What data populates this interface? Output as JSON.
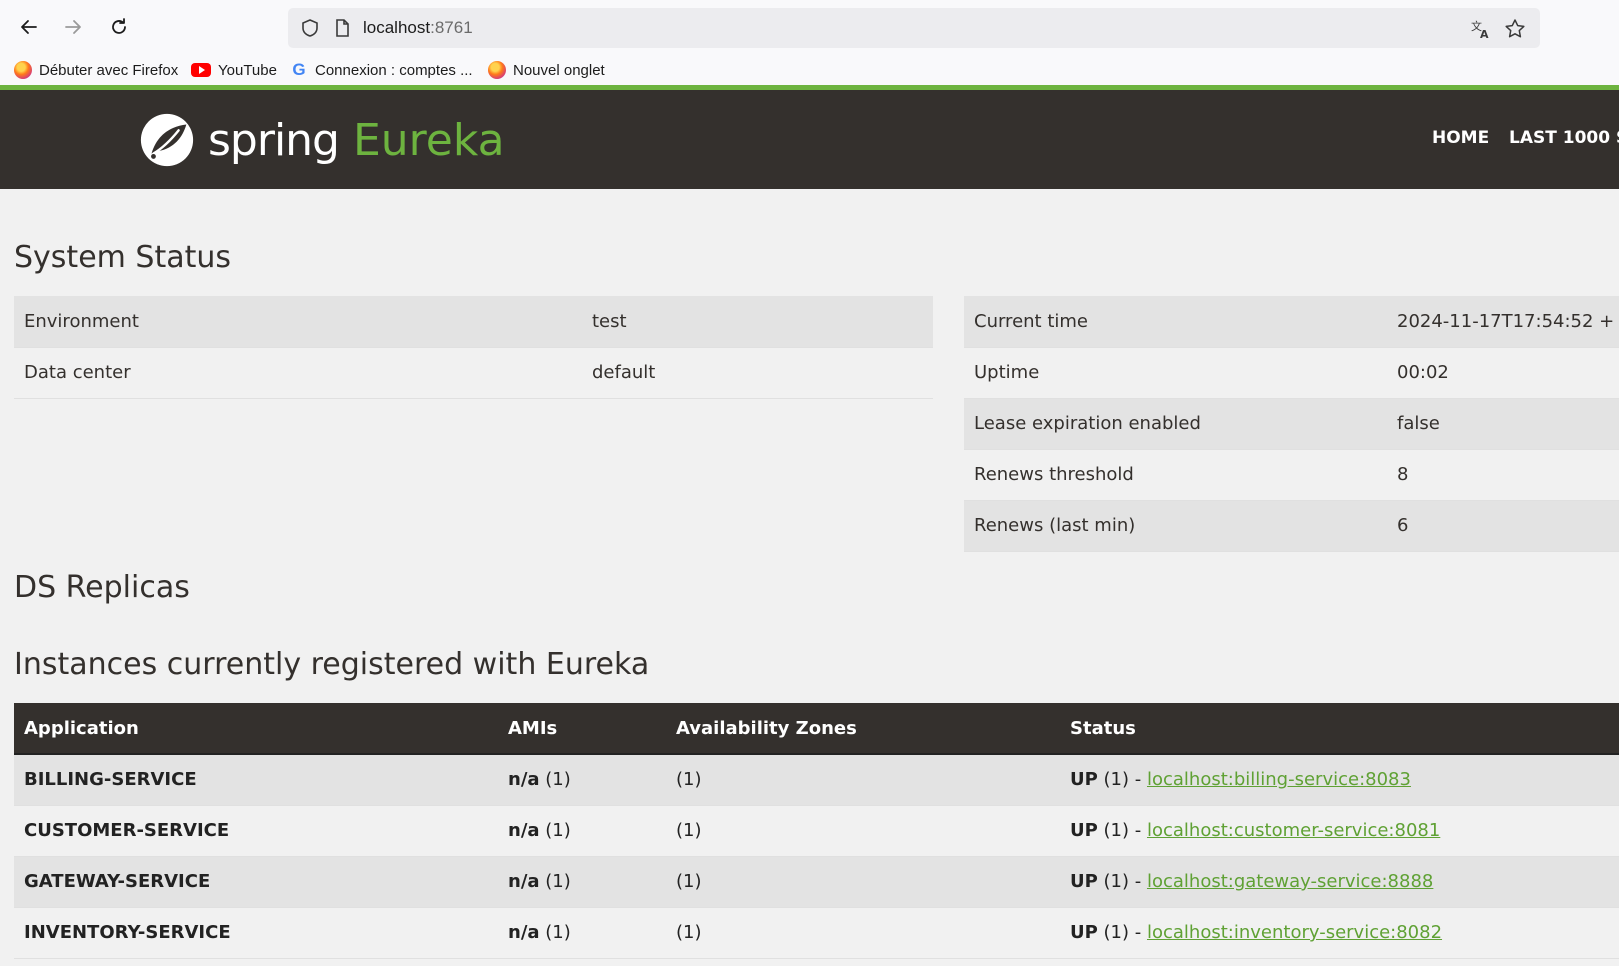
{
  "browser": {
    "url_host": "localhost",
    "url_port": ":8761",
    "bookmarks": [
      "Débuter avec Firefox",
      "YouTube",
      "Connexion : comptes ...",
      "Nouvel onglet"
    ]
  },
  "header": {
    "logo_spring": "spring",
    "logo_eureka": "Eureka",
    "nav": [
      "HOME",
      "LAST 1000 S"
    ]
  },
  "system_status": {
    "title": "System Status",
    "left": [
      {
        "label": "Environment",
        "value": "test"
      },
      {
        "label": "Data center",
        "value": "default"
      }
    ],
    "right": [
      {
        "label": "Current time",
        "value": "2024-11-17T17:54:52 +"
      },
      {
        "label": "Uptime",
        "value": "00:02"
      },
      {
        "label": "Lease expiration enabled",
        "value": "false"
      },
      {
        "label": "Renews threshold",
        "value": "8"
      },
      {
        "label": "Renews (last min)",
        "value": "6"
      }
    ]
  },
  "ds_replicas": {
    "title": "DS Replicas"
  },
  "instances": {
    "title": "Instances currently registered with Eureka",
    "columns": [
      "Application",
      "AMIs",
      "Availability Zones",
      "Status"
    ],
    "rows": [
      {
        "app": "BILLING-SERVICE",
        "ami": "n/a",
        "ami_count": " (1)",
        "zones": "(1)",
        "status": "UP",
        "status_count": " (1) - ",
        "link": "localhost:billing-service:8083"
      },
      {
        "app": "CUSTOMER-SERVICE",
        "ami": "n/a",
        "ami_count": " (1)",
        "zones": "(1)",
        "status": "UP",
        "status_count": " (1) - ",
        "link": "localhost:customer-service:8081"
      },
      {
        "app": "GATEWAY-SERVICE",
        "ami": "n/a",
        "ami_count": " (1)",
        "zones": "(1)",
        "status": "UP",
        "status_count": " (1) - ",
        "link": "localhost:gateway-service:8888"
      },
      {
        "app": "INVENTORY-SERVICE",
        "ami": "n/a",
        "ami_count": " (1)",
        "zones": "(1)",
        "status": "UP",
        "status_count": " (1) - ",
        "link": "localhost:inventory-service:8082"
      }
    ]
  }
}
